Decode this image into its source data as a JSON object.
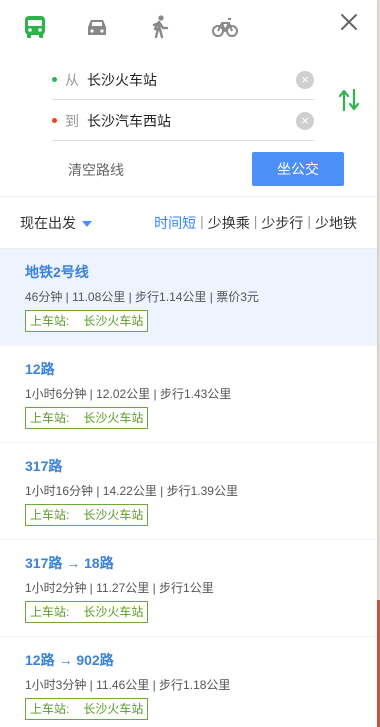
{
  "modes": [
    {
      "icon": "bus-icon",
      "active": true
    },
    {
      "icon": "car-icon",
      "active": false
    },
    {
      "icon": "walk-icon",
      "active": false
    },
    {
      "icon": "bike-icon",
      "active": false
    }
  ],
  "route": {
    "from_prefix": "从",
    "from_value": "长沙火车站",
    "to_prefix": "到",
    "to_value": "长沙汽车西站",
    "clear_label": "清空路线",
    "go_label": "坐公交"
  },
  "filter": {
    "depart_label": "现在出发",
    "sorts": [
      "时间短",
      "少换乘",
      "少步行",
      "少地铁"
    ],
    "active_sort": 0
  },
  "plans": [
    {
      "title": "地铁2号线",
      "meta": "46分钟 | 11.08公里 | 步行1.14公里 | 票价3元",
      "station_label": "上车站:",
      "station": "长沙火车站",
      "selected": true
    },
    {
      "title": "12路",
      "meta": "1小时6分钟 | 12.02公里 | 步行1.43公里",
      "station_label": "上车站:",
      "station": "长沙火车站"
    },
    {
      "title": "317路",
      "meta": "1小时16分钟 | 14.22公里 | 步行1.39公里",
      "station_label": "上车站:",
      "station": "长沙火车站"
    },
    {
      "title": "317路 → 18路",
      "meta": "1小时2分钟 | 11.27公里 | 步行1公里",
      "station_label": "上车站:",
      "station": "长沙火车站"
    },
    {
      "title": "12路 → 902路",
      "meta": "1小时3分钟 | 11.46公里 | 步行1.18公里",
      "station_label": "上车站:",
      "station": "长沙火车站"
    }
  ],
  "colors": {
    "accent": "#4c8ff7",
    "link": "#3b82d9",
    "green": "#5a9a2a",
    "from_dot": "#2cb34a",
    "to_dot": "#e8442b"
  }
}
